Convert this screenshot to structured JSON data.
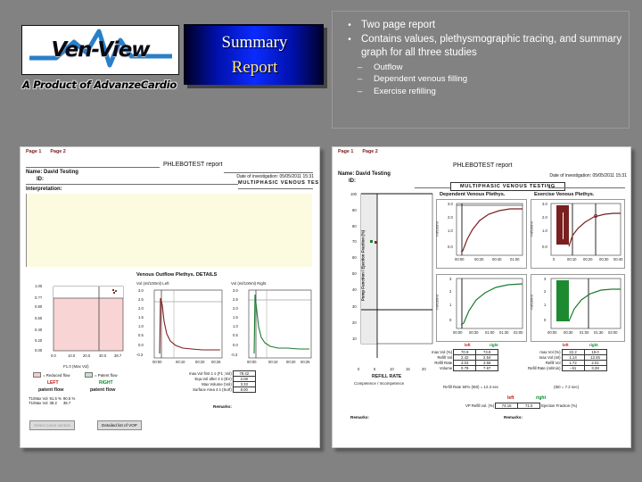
{
  "logo": {
    "brand": "Ven-View",
    "tagline": "A Product of AdvanzeCardio"
  },
  "plaque": {
    "line1": "Summary",
    "line2": "Report",
    "gradient_center": "#0b2bff",
    "gradient_edge": "#000025",
    "line1_color": "#ffffff",
    "line2_color": "#ffe680"
  },
  "bullets": [
    {
      "level": 1,
      "marker": "•",
      "text": "Two page report"
    },
    {
      "level": 1,
      "marker": "•",
      "text": "Contains values, plethysmographic tracing, and summary graph for all three studies"
    },
    {
      "level": 2,
      "marker": "–",
      "text": "Outflow"
    },
    {
      "level": 2,
      "marker": "–",
      "text": "Dependent venous filling"
    },
    {
      "level": 2,
      "marker": "–",
      "text": "Exercise refilling"
    }
  ],
  "report_common": {
    "tab_page1": "Page 1",
    "tab_page2": "Page 2",
    "title": "PHLEBOTEST report",
    "name_label": "Name:",
    "name_value": "David Testing",
    "id_label": "ID:",
    "date_label": "Date of investigation:",
    "date_value": "05/05/2011 15:31",
    "subtitle": "MULTIPHASIC VENOUS TESTING"
  },
  "page1": {
    "interpretation_label": "Interpretation:",
    "section_title": "Venous Outflow Plethys. DETAILS",
    "summary_chart": {
      "yticks": [
        "1.00",
        "0.??",
        "0.80",
        "0.60",
        "0.40",
        "0.20",
        "0.00"
      ],
      "xticks": [
        "0.0",
        "10.0",
        "20.0",
        "30.0",
        "38.7"
      ],
      "xlabel": "F1.0 (Max Vol)",
      "marker_color": "#8b2a2a",
      "fill_color": "#f8d4d4"
    },
    "trace_left": {
      "caption": "Vol (ml/100ml) Left",
      "yticks": [
        "3.0",
        "2.5",
        "2.0",
        "1.5",
        "1.0",
        "0.5",
        "0.0",
        "-0.3"
      ],
      "xticks": [
        "00:00",
        "00:10",
        "00:20",
        "00:26"
      ],
      "color": "#7a1f1f"
    },
    "trace_right": {
      "caption": "Vol (ml/100ml) Right",
      "yticks": [
        "3.0",
        "2.5",
        "2.0",
        "1.5",
        "1.0",
        "0.5",
        "0.0",
        "-0.3"
      ],
      "xticks": [
        "00:00",
        "00:10",
        "00:20",
        "00:26"
      ],
      "color": "#1e7a30"
    },
    "legend": [
      {
        "swatch": "red",
        "text": "= Reduced flow"
      },
      {
        "swatch": "green",
        "text": "= Patent flow"
      }
    ],
    "verdict_left_tag": "LEFT",
    "verdict_right_tag": "RIGHT",
    "verdict_left": "patent flow",
    "verdict_right": "patent flow",
    "rows": [
      {
        "label": "T1/Max Vol",
        "left": "91.5 %",
        "right": "90.5 %"
      },
      {
        "label": "T1/Max Vol",
        "left": "38.2",
        "right": "38.7"
      }
    ],
    "metrics": [
      {
        "label": "max.Vol first 1 s (F1 ,Vol)",
        "value": "78.42"
      },
      {
        "label": "Equ.Vol after 4 s (EV)",
        "value": "2.08"
      },
      {
        "label": "Max Volume (Vol)",
        "value": "3.33"
      },
      {
        "label": "Surface Area 4 s (Surf)",
        "value": "8.00"
      }
    ],
    "remarks_label": "Remarks:",
    "buttons": [
      {
        "label": "Select curve section",
        "state": "disabled"
      },
      {
        "label": "Detailed list of VOP",
        "state": "enabled"
      }
    ]
  },
  "page2": {
    "pump_chart": {
      "ylabel": "Pump Function / Ejection Fraction (%)",
      "yticks": [
        "100",
        "90",
        "80",
        "70",
        "60",
        "50",
        "40",
        "30",
        "20",
        "10"
      ],
      "xticks": [
        "0",
        "5",
        "10",
        "15",
        "20"
      ],
      "xlabel": "REFILL RATE",
      "sublabel": "Competence / Incompetence",
      "marker_left_color": "#1e7a30",
      "marker_right_color": "#8b2a2a"
    },
    "dependent_chart": {
      "title": "Dependent Venous Plethys.",
      "ylabel": "ml/100ml",
      "yticks": [
        "3.0",
        "2.0",
        "1.0",
        "0.0"
      ],
      "xticks": [
        "00:00",
        "00:20",
        "00:40",
        "01:00"
      ],
      "color": "#7a1f1f"
    },
    "exercise_chart": {
      "title": "Exercise Venous Plethys.",
      "ylabel": "ml/100ml",
      "yticks": [
        "3.0",
        "2.0",
        "1.0",
        "0.0"
      ],
      "xticks": [
        "0",
        "00:10",
        "00:20",
        "00:30",
        "00:40"
      ],
      "color": "#7a1f1f"
    },
    "dependent_chart2": {
      "ylabel": "ml/100ml",
      "yticks": [
        "3",
        "2",
        "1",
        "0"
      ],
      "xticks": [
        "00:00",
        "00:30",
        "01:00",
        "01:30",
        "02:00"
      ],
      "color": "#1e7a30"
    },
    "exercise_chart2": {
      "ylabel": "ml/100ml",
      "yticks": [
        "3",
        "2",
        "1",
        "0"
      ],
      "xticks": [
        "00:00",
        "00:30",
        "01:00",
        "01:30",
        "02:00"
      ],
      "color": "#1e7a30"
    },
    "col_left": "left",
    "col_right": "right",
    "dep_rows": [
      {
        "label": "max Vol (%)",
        "left": "70.9",
        "right": "73.8"
      },
      {
        "label": "Refill Vol",
        "left": "2.42",
        "right": "2.54"
      },
      {
        "label": "Refill Rate",
        "left": "3.03",
        "right": "3.55"
      },
      {
        "label": "Volume",
        "left": "0.79",
        "right": "7.67"
      }
    ],
    "ex_rows": [
      {
        "label": "max Vol (%)",
        "left": "22.2",
        "right": "19.0"
      },
      {
        "label": "max Vol (ml)",
        "left": "1.14",
        "right": "13.45"
      },
      {
        "label": "Refill Vol",
        "left": "1.72",
        "right": "2.01"
      },
      {
        "label": "Refill Rate (ml/min)",
        "left": "-.61",
        "right": "3.28"
      }
    ],
    "footnote_left": "Refill Rate 50% (t50) = 12.3 sec",
    "footnote_right": "(t50 = 7.2 sec)",
    "ef_label_left": "VP Refill vol. (%)",
    "ef_label_right": "Ejection Fraction (%)",
    "ef_left": "74.15",
    "ef_right": "71.0",
    "remarks_label": "Remarks:"
  }
}
